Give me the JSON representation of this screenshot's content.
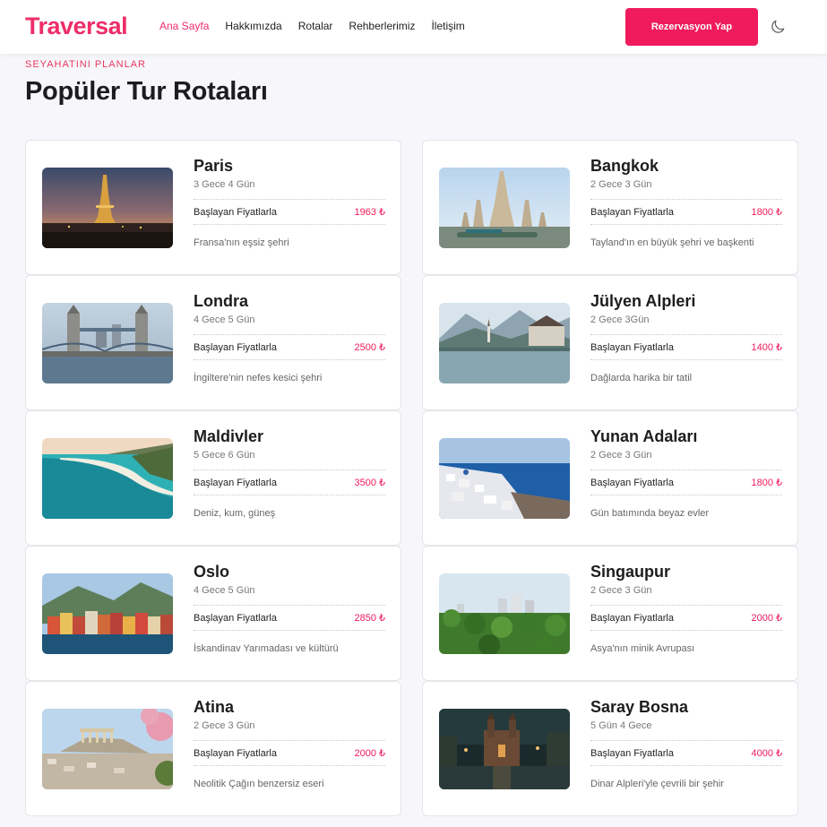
{
  "brand": "Traversal",
  "nav": {
    "items": [
      "Ana Sayfa",
      "Hakkımızda",
      "Rotalar",
      "Rehberlerimiz",
      "İletişim"
    ],
    "cta_label": "Rezervasyon Yap",
    "theme_icon": "moon-icon"
  },
  "section": {
    "eyebrow": "SEYAHATINI PLANLAR",
    "title": "Popüler Tur Rotaları"
  },
  "price_label": "Başlayan Fiyatlarla",
  "tours": [
    {
      "name": "Paris",
      "duration": "3 Gece 4 Gün",
      "price": "1963 ₺",
      "desc": "Fransa'nın eşsiz şehri",
      "image": "paris-eiffel-night"
    },
    {
      "name": "Bangkok",
      "duration": "2 Gece 3 Gün",
      "price": "1800 ₺",
      "desc": "Tayland'ın en büyük şehri ve başkenti",
      "image": "bangkok-temple"
    },
    {
      "name": "Londra",
      "duration": "4 Gece 5 Gün",
      "price": "2500 ₺",
      "desc": "İngiltere'nin nefes kesici şehri",
      "image": "london-tower-bridge"
    },
    {
      "name": "Jülyen Alpleri",
      "duration": "2 Gece 3Gün",
      "price": "1400 ₺",
      "desc": "Dağlarda harika bir tatil",
      "image": "alps-lake-village"
    },
    {
      "name": "Maldivler",
      "duration": "5 Gece 6 Gün",
      "price": "3500 ₺",
      "desc": "Deniz, kum, güneş",
      "image": "maldives-beach"
    },
    {
      "name": "Yunan Adaları",
      "duration": "2 Gece 3 Gün",
      "price": "1800 ₺",
      "desc": "Gün batımında beyaz evler",
      "image": "greek-island-white-houses"
    },
    {
      "name": "Oslo",
      "duration": "4 Gece 5 Gün",
      "price": "2850 ₺",
      "desc": "İskandinav Yarımadası ve kültürü",
      "image": "oslo-harbour-houses"
    },
    {
      "name": "Singaupur",
      "duration": "2 Gece 3 Gün",
      "price": "2000 ₺",
      "desc": "Asya'nın minik Avrupası",
      "image": "singapore-green-city"
    },
    {
      "name": "Atina",
      "duration": "2 Gece 3 Gün",
      "price": "2000 ₺",
      "desc": "Neolitik Çağın benzersiz eseri",
      "image": "athens-acropolis"
    },
    {
      "name": "Saray Bosna",
      "duration": "5 Gün 4 Gece",
      "price": "4000 ₺",
      "desc": "Dinar Alpleri'yle çevrili bir şehir",
      "image": "sarajevo-rainy-night"
    }
  ]
}
